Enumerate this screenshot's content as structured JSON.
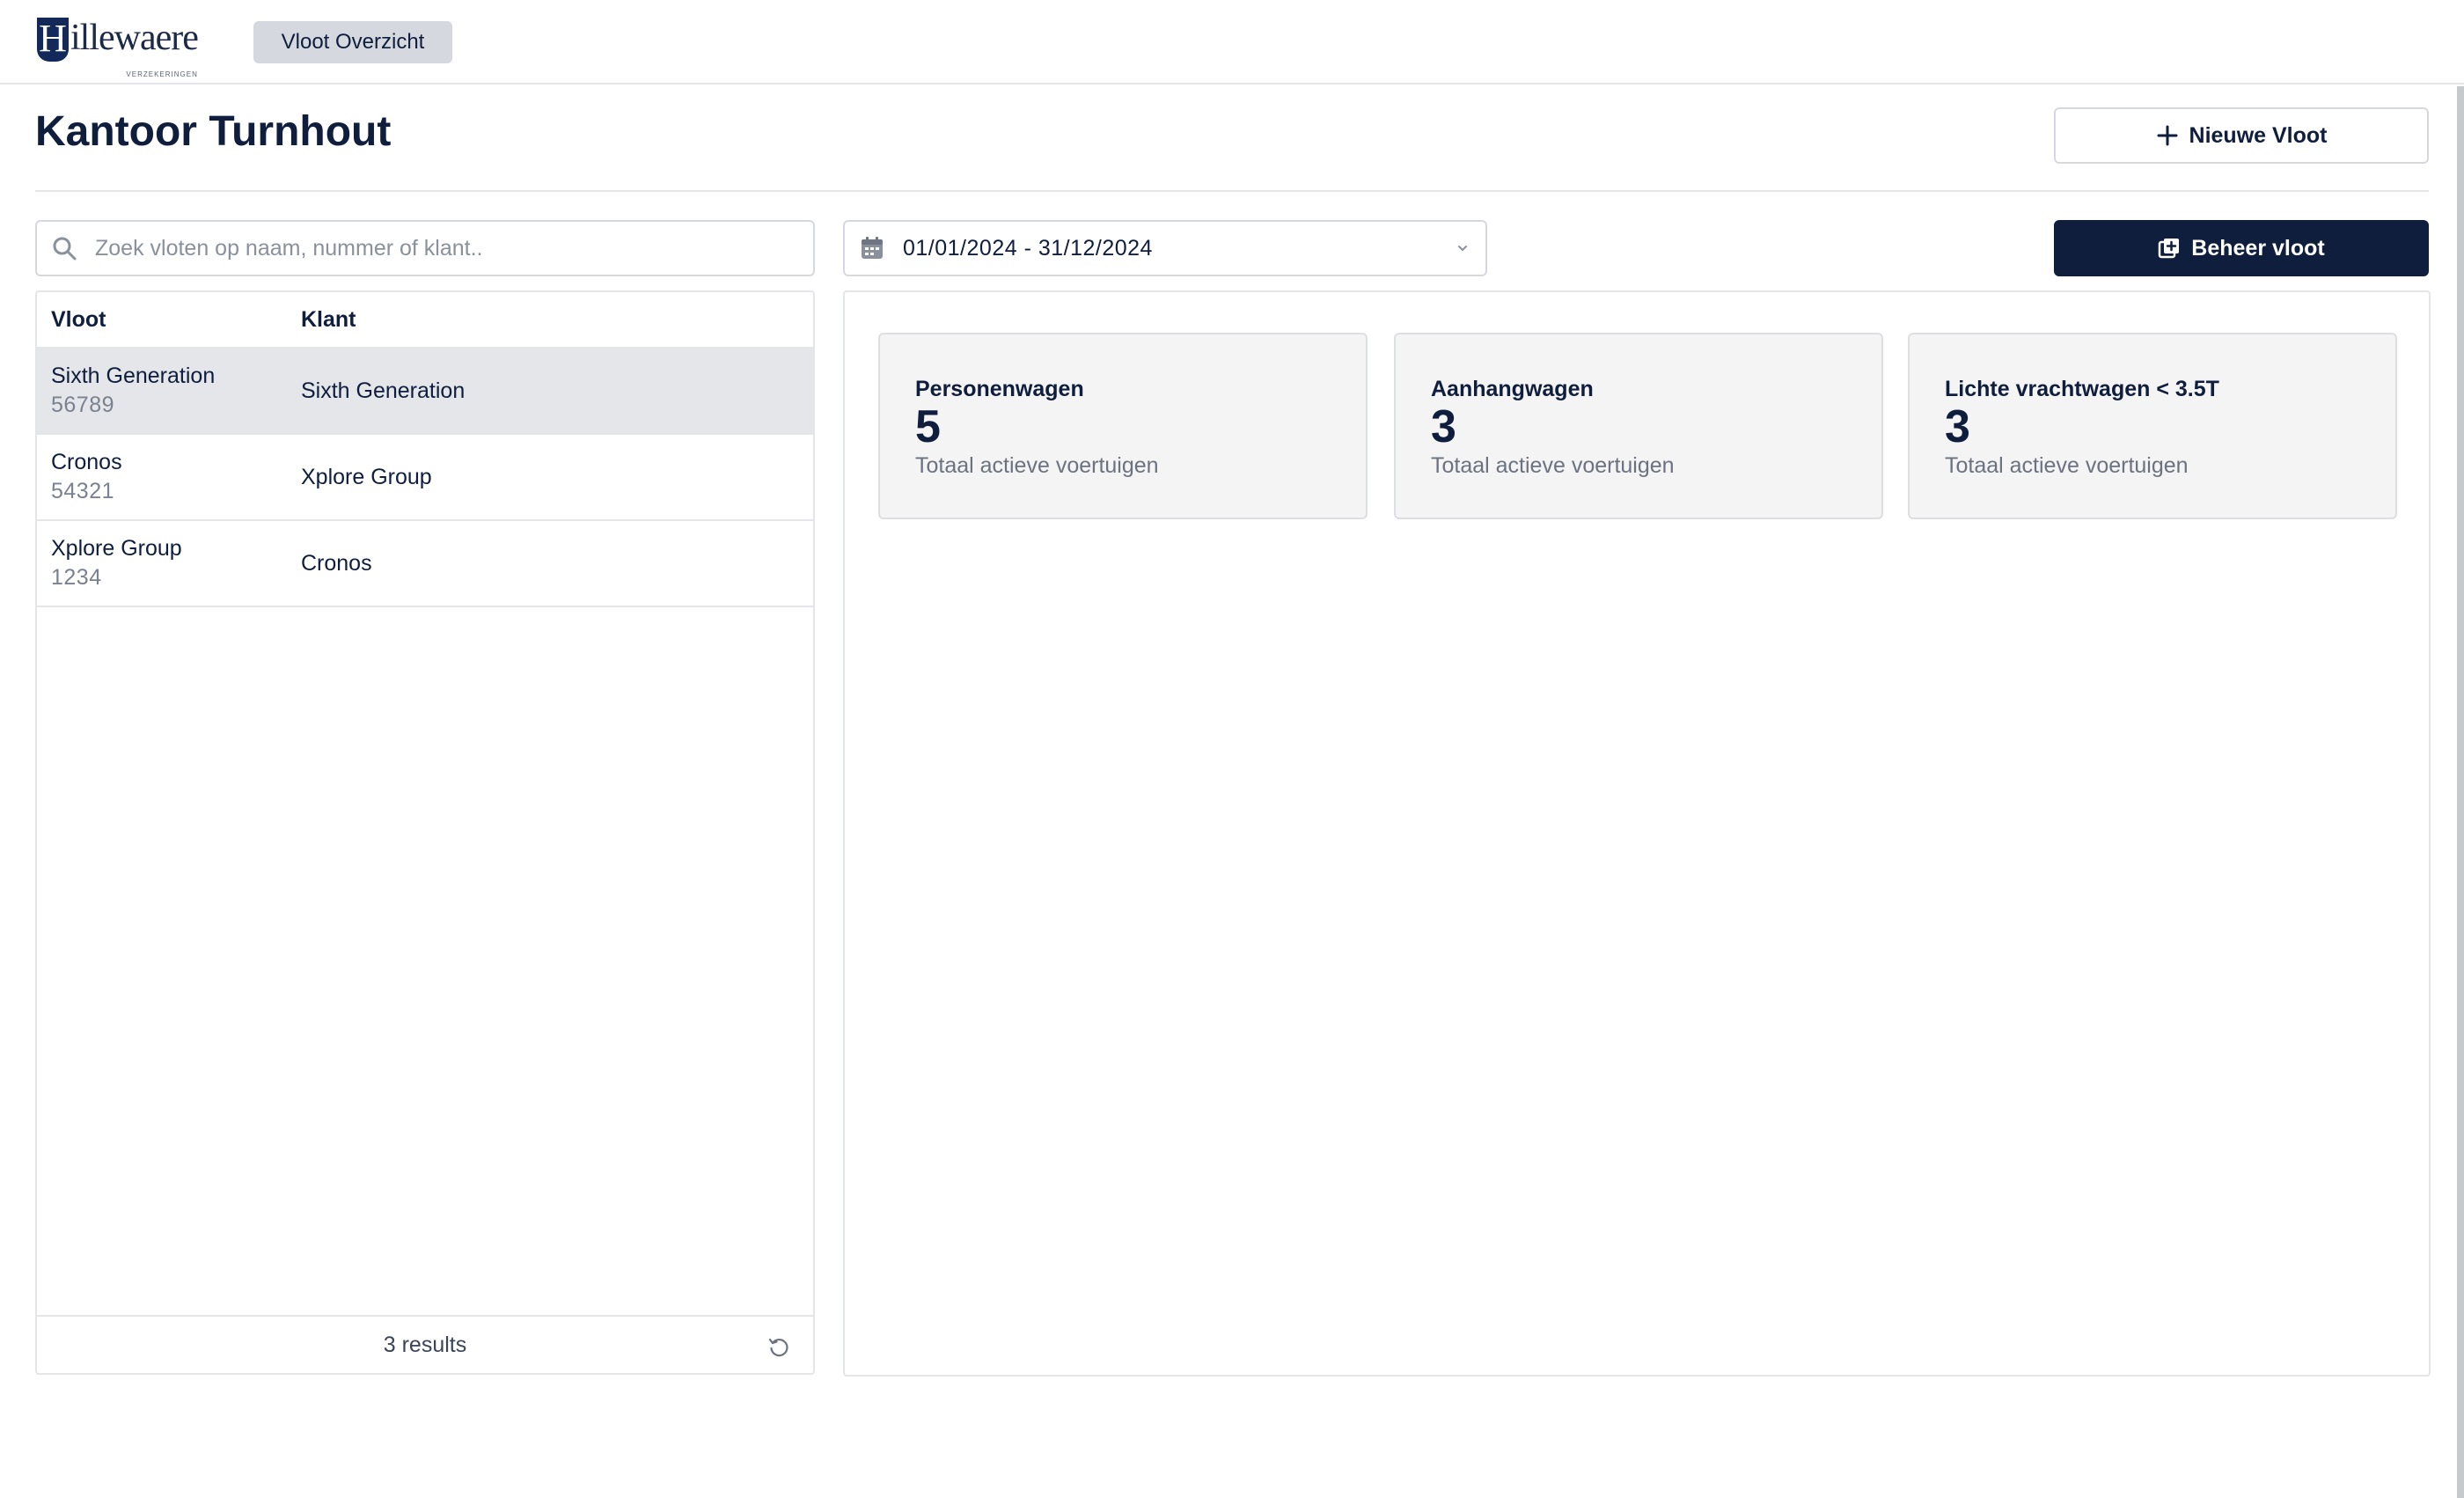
{
  "header": {
    "logo_initial": "H",
    "logo_text": "illewaere",
    "logo_subtext": "VERZEKERINGEN",
    "nav_label": "Vloot Overzicht"
  },
  "page": {
    "title": "Kantoor Turnhout",
    "new_button_label": "Nieuwe Vloot",
    "manage_button_label": "Beheer vloot"
  },
  "search": {
    "placeholder": "Zoek vloten op naam, nummer of klant..",
    "value": ""
  },
  "date_range": {
    "value": "01/01/2024 - 31/12/2024"
  },
  "table": {
    "columns": [
      "Vloot",
      "Klant"
    ],
    "rows": [
      {
        "name": "Sixth Generation",
        "number": "56789",
        "klant": "Sixth Generation",
        "selected": true
      },
      {
        "name": "Cronos",
        "number": "54321",
        "klant": "Xplore Group",
        "selected": false
      },
      {
        "name": "Xplore Group",
        "number": "1234",
        "klant": "Cronos",
        "selected": false
      }
    ],
    "results_label": "3 results"
  },
  "cards": [
    {
      "title": "Personenwagen",
      "value": "5",
      "subtitle": "Totaal actieve voertuigen"
    },
    {
      "title": "Aanhangwagen",
      "value": "3",
      "subtitle": "Totaal actieve voertuigen"
    },
    {
      "title": "Lichte vrachtwagen < 3.5T",
      "value": "3",
      "subtitle": "Totaal actieve voertuigen"
    }
  ],
  "colors": {
    "brand_navy": "#0f1e3d",
    "selected_row": "#e4e6ea",
    "card_bg": "#f4f4f4",
    "border": "#e3e5e9"
  },
  "icons": {
    "plus": "plus-icon",
    "search": "search-icon",
    "calendar": "calendar-icon",
    "chevron": "chevron-down-icon",
    "manage": "gallery-add-icon",
    "refresh": "refresh-icon"
  }
}
